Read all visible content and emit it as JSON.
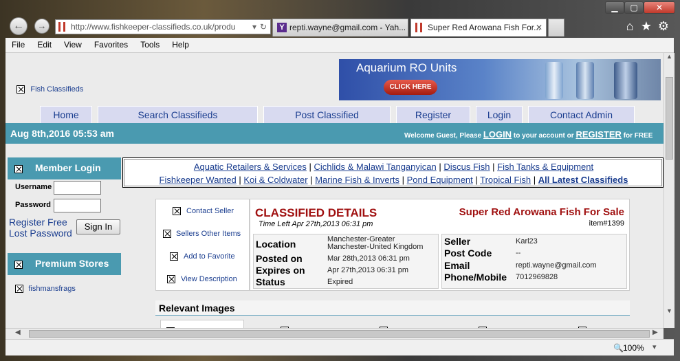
{
  "window": {
    "minimize": "▁",
    "maximize": "▢",
    "close": "✕"
  },
  "browser": {
    "address": "http://www.fishkeeper-classifieds.co.uk/produ",
    "tabs": [
      {
        "label": "repti.wayne@gmail.com - Yah..."
      },
      {
        "label": "Super Red Arowana Fish For..."
      }
    ],
    "tab_close": "✕",
    "menu": [
      "File",
      "Edit",
      "View",
      "Favorites",
      "Tools",
      "Help"
    ],
    "zoom": "100%"
  },
  "site": {
    "logo_alt": "Fish Classifieds",
    "banner": {
      "title": "Aquarium RO Units",
      "button": "CLICK HERE"
    },
    "nav": [
      "Home",
      "Search Classifieds",
      "Post Classified",
      "Register",
      "Login",
      "Contact Admin"
    ],
    "date": "Aug 8th,2016 05:53 am",
    "welcome": {
      "prefix": "Welcome",
      "guest": "Guest",
      "please": ", Please",
      "login": "LOGIN",
      "mid": "to your account or",
      "register": "REGISTER",
      "suffix": "for FREE"
    }
  },
  "sidebar": {
    "member_login": "Member Login",
    "username_label": "Username",
    "password_label": "Password",
    "register_link": "Register Free",
    "lost_password_link": "Lost Password",
    "signin_button": "Sign In",
    "premium_title": "Premium Stores",
    "store": "fishmansfrags"
  },
  "categories": {
    "row1": [
      "Aquatic Retailers & Services",
      "Cichlids & Malawi Tanganyican",
      "Discus Fish",
      "Fish Tanks & Equipment"
    ],
    "row2": [
      "Fishkeeper Wanted",
      "Koi & Coldwater",
      "Marine Fish & Inverts",
      "Pond Equipment",
      "Tropical Fish",
      "All Latest Classifieds"
    ]
  },
  "actions": [
    "Contact Seller",
    "Sellers Other Items",
    "Add to Favorite",
    "View Description"
  ],
  "details": {
    "heading": "CLASSIFIED DETAILS",
    "time_left": "Time Left Apr 27th,2013 06:31 pm",
    "title": "Super Red Arowana Fish For Sale",
    "item": "item#1399",
    "left": [
      {
        "label": "Location",
        "value": "Manchester-Greater Manchester-United Kingdom"
      },
      {
        "label": "Posted on",
        "value": "Mar 28th,2013 06:31 pm"
      },
      {
        "label": "Expires on",
        "value": "Apr 27th,2013 06:31 pm"
      },
      {
        "label": "Status",
        "value": "Expired"
      }
    ],
    "right": [
      {
        "label": "Seller",
        "value": "Karl23"
      },
      {
        "label": "Post Code",
        "value": "--"
      },
      {
        "label": "Email",
        "value": "repti.wayne@gmail.com"
      },
      {
        "label": "Phone/Mobile",
        "value": "7012969828"
      }
    ],
    "images_heading": "Relevant Images"
  },
  "colors": {
    "accent": "#4a9ab0",
    "title_red": "#a01010",
    "link": "#1a3d8f"
  }
}
